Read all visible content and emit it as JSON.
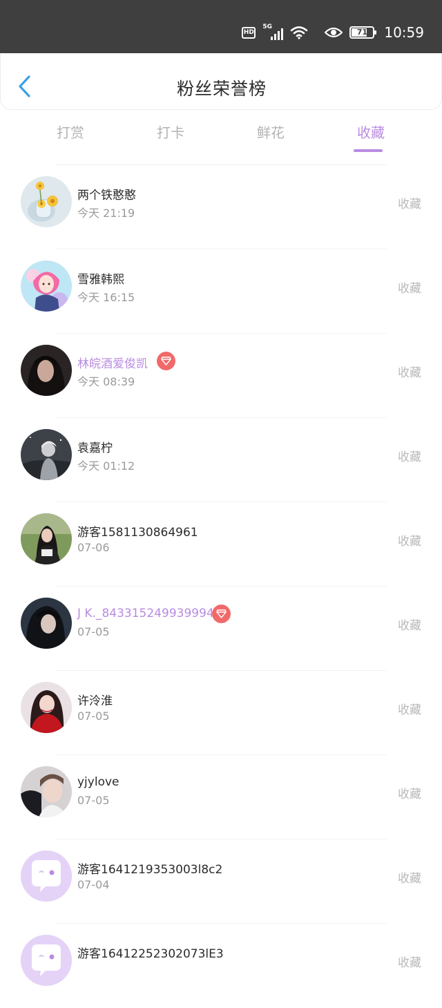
{
  "status_bar": {
    "hd": "HD",
    "network": "5G",
    "battery": "71",
    "time": "10:59"
  },
  "header": {
    "title": "粉丝荣誉榜",
    "back_icon": "chevron-left-icon"
  },
  "tabs": [
    {
      "label": "打赏",
      "active": false
    },
    {
      "label": "打卡",
      "active": false
    },
    {
      "label": "鲜花",
      "active": false
    },
    {
      "label": "收藏",
      "active": true
    }
  ],
  "accent_color": "#b98be2",
  "list": [
    {
      "name": "两个铁憨憨",
      "time": "今天 21:19",
      "action": "收藏",
      "vip": false,
      "avatar": "flowers-photo"
    },
    {
      "name": "雪雅韩熙",
      "time": "今天 16:15",
      "action": "收藏",
      "vip": false,
      "avatar": "anime-girl"
    },
    {
      "name": "林皖酒爱俊凯",
      "time": "今天 08:39",
      "action": "收藏",
      "vip": true,
      "avatar": "dark-portrait"
    },
    {
      "name": "袁嘉柠",
      "time": "今天 01:12",
      "action": "收藏",
      "vip": false,
      "avatar": "night-portrait"
    },
    {
      "name": "游客1581130864961",
      "time": "07-06",
      "action": "收藏",
      "vip": false,
      "avatar": "outdoor-girl"
    },
    {
      "name": "J K._843315249939994",
      "time": "07-05",
      "action": "收藏",
      "vip": true,
      "avatar": "dark-girl"
    },
    {
      "name": "许泠淮",
      "time": "07-05",
      "action": "收藏",
      "vip": false,
      "avatar": "red-dress-girl"
    },
    {
      "name": "yjylove",
      "time": "07-05",
      "action": "收藏",
      "vip": false,
      "avatar": "boy-portrait"
    },
    {
      "name": "游客1641219353003l8c2",
      "time": "07-04",
      "action": "收藏",
      "vip": false,
      "avatar": "default-chat-avatar"
    },
    {
      "name": "游客16412252302073lE3",
      "time": "",
      "action": "收藏",
      "vip": false,
      "avatar": "default-chat-avatar"
    }
  ]
}
